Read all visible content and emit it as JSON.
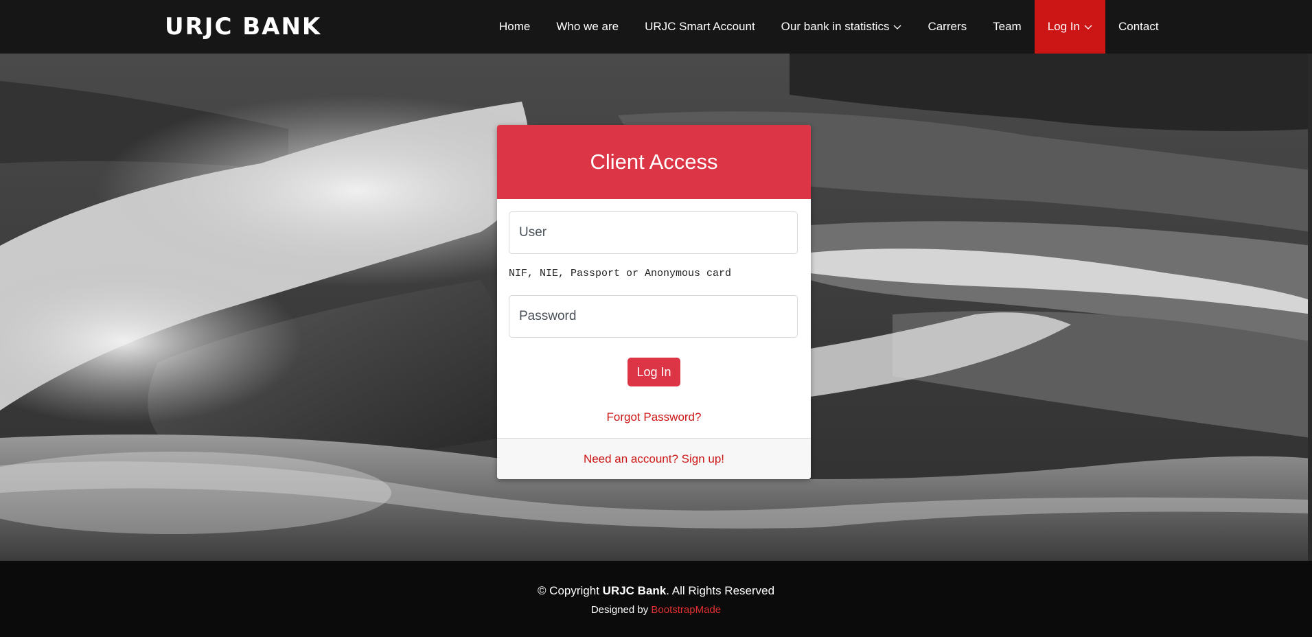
{
  "header": {
    "brand": "URJC BANK",
    "nav": [
      {
        "label": "Home"
      },
      {
        "label": "Who we are"
      },
      {
        "label": "URJC Smart Account"
      },
      {
        "label": "Our bank in statistics"
      },
      {
        "label": "Carrers"
      },
      {
        "label": "Team"
      },
      {
        "label": "Log In"
      },
      {
        "label": "Contact"
      }
    ],
    "active_color": "#cc1616"
  },
  "login_card": {
    "title": "Client Access",
    "user_placeholder": "User",
    "user_hint": "NIF, NIE, Passport or Anonymous card",
    "password_placeholder": "Password",
    "login_button": "Log In",
    "forgot_link": "Forgot Password?",
    "signup_link": "Need an account? Sign up!",
    "accent_color": "#dc3545"
  },
  "footer": {
    "copyright_prefix": "© Copyright ",
    "copyright_brand": "URJC Bank",
    "copyright_suffix": ". All Rights Reserved",
    "designed_prefix": "Designed by ",
    "designed_link": "BootstrapMade"
  },
  "icons": {
    "dropdown": "chevron-down-icon"
  }
}
